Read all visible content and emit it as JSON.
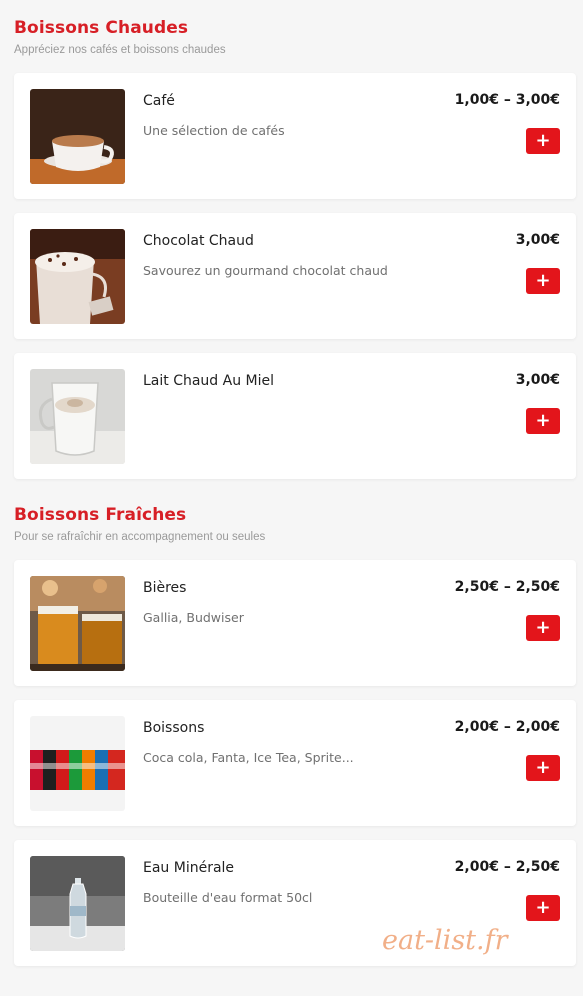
{
  "colors": {
    "accent": "#e3151b",
    "section_title": "#d71f26",
    "background": "#f6f6f6",
    "watermark": "#f0a77c"
  },
  "sections": [
    {
      "title": "Boissons Chaudes",
      "subtitle": "Appréciez nos cafés et boissons chaudes",
      "items": [
        {
          "name": "Café",
          "description": "Une sélection de cafés",
          "price": "1,00€ – 3,00€",
          "add_label": "+",
          "image": "coffee-cup-image"
        },
        {
          "name": "Chocolat Chaud",
          "description": "Savourez un gourmand chocolat chaud",
          "price": "3,00€",
          "add_label": "+",
          "image": "hot-chocolate-image"
        },
        {
          "name": "Lait Chaud Au Miel",
          "description": "",
          "price": "3,00€",
          "add_label": "+",
          "image": "honey-milk-image"
        }
      ]
    },
    {
      "title": "Boissons Fraîches",
      "subtitle": "Pour se rafraîchir en accompagnement ou seules",
      "items": [
        {
          "name": "Bières",
          "description": "Gallia, Budwiser",
          "price": "2,50€ – 2,50€",
          "add_label": "+",
          "image": "beer-glasses-image"
        },
        {
          "name": "Boissons",
          "description": "Coca cola, Fanta, Ice Tea, Sprite...",
          "price": "2,00€ – 2,00€",
          "add_label": "+",
          "image": "soda-cans-image"
        },
        {
          "name": "Eau Minérale",
          "description": "Bouteille d'eau format 50cl",
          "price": "2,00€ – 2,50€",
          "add_label": "+",
          "image": "water-bottle-image"
        }
      ]
    }
  ],
  "watermark": "eat-list.fr"
}
